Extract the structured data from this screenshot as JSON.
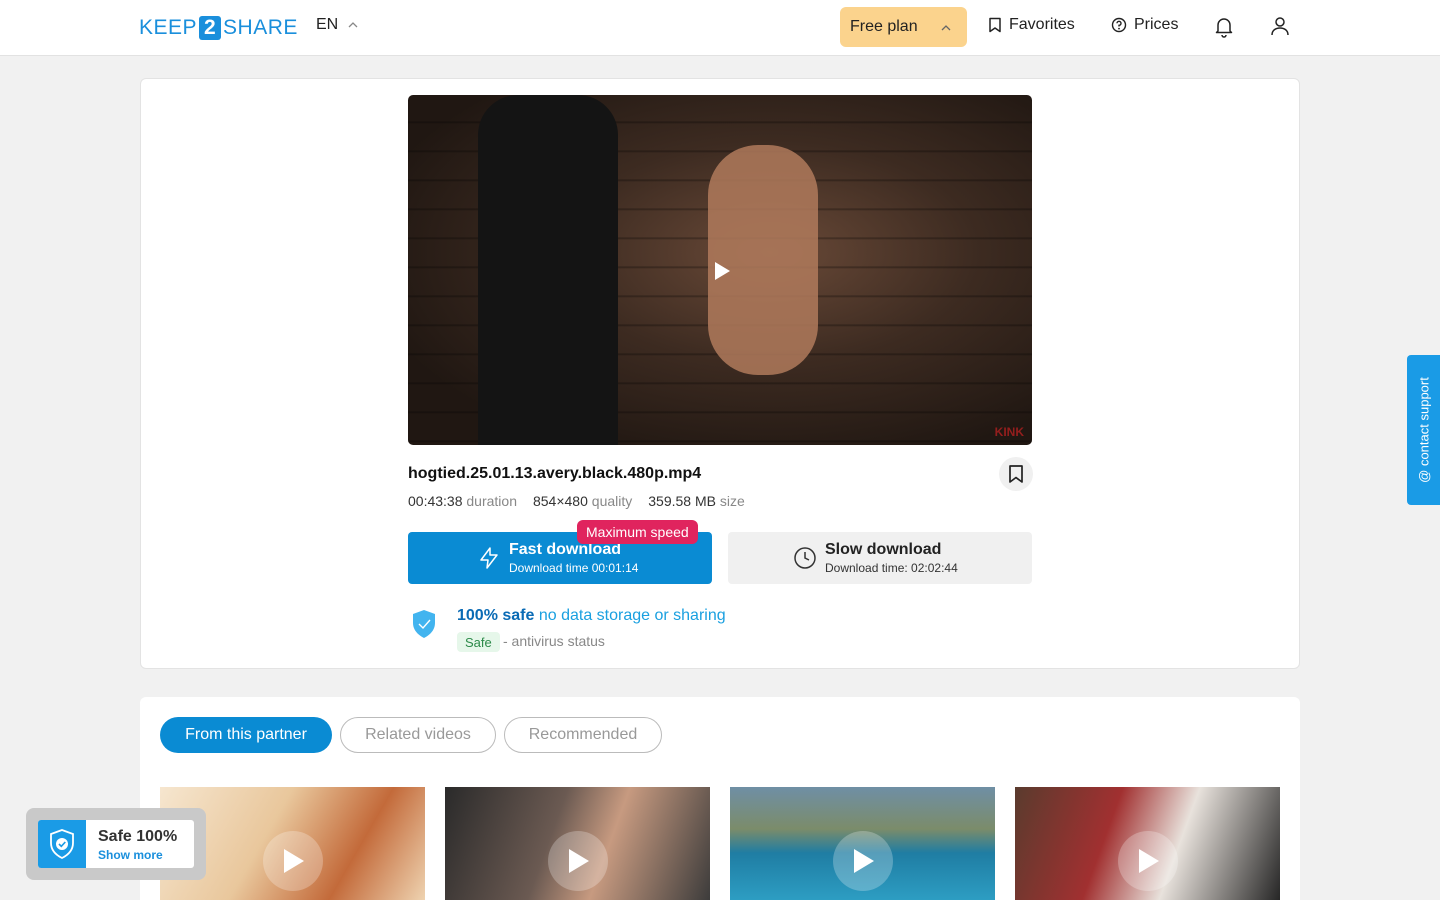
{
  "header": {
    "logo_left": "KEEP",
    "logo_num": "2",
    "logo_right": "SHARE",
    "lang": "EN",
    "plan_label": "Free plan",
    "favorites_label": "Favorites",
    "prices_label": "Prices"
  },
  "file": {
    "name": "hogtied.25.01.13.avery.black.480p.mp4",
    "duration_value": "00:43:38",
    "duration_label": "duration",
    "quality_value": "854×480",
    "quality_label": "quality",
    "size_value": "359.58 MB",
    "size_label": "size",
    "watermark": "KINK"
  },
  "download": {
    "badge": "Maximum speed",
    "fast_title": "Fast download",
    "fast_sub": "Download time 00:01:14",
    "slow_title": "Slow download",
    "slow_sub": "Download time: 02:02:44"
  },
  "safety": {
    "headline": "100% safe",
    "tagline": "no data storage or sharing",
    "chip": "Safe",
    "status": "- antivirus status"
  },
  "support_label": "@ contact support",
  "tabs": [
    {
      "label": "From this partner",
      "active": true
    },
    {
      "label": "Related videos",
      "active": false
    },
    {
      "label": "Recommended",
      "active": false
    }
  ],
  "toast": {
    "title": "Safe 100%",
    "link": "Show more"
  },
  "colors": {
    "primary": "#0a8bd3",
    "plan": "#fbd38d",
    "badge": "#e0245e",
    "support": "#1a9be6"
  }
}
